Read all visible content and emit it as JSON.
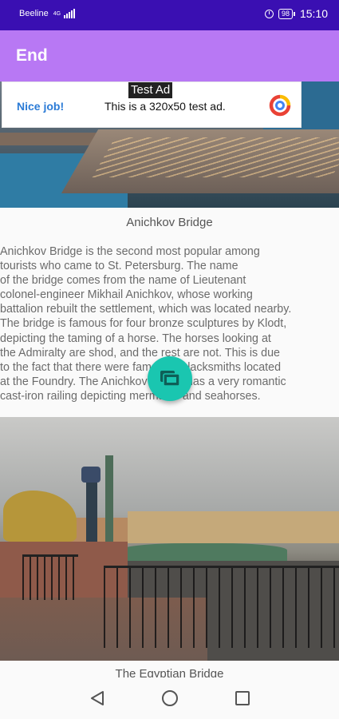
{
  "status_bar": {
    "carrier": "Beeline",
    "network": "4G",
    "battery": "98",
    "time": "15:10"
  },
  "app_bar": {
    "title": "End"
  },
  "ad": {
    "tag": "Test Ad",
    "headline": "Nice job!",
    "body": "This is a 320x50 test ad."
  },
  "content": {
    "caption1": "Anichkov Bridge",
    "description": "Anichkov Bridge is the second most popular among\ntourists who came to St. Petersburg. The name\nof the bridge comes from the name of Lieutenant\ncolonel-engineer Mikhail Anichkov, whose working\nbattalion rebuilt the settlement, which was located nearby.\nThe bridge is famous for four bronze sculptures by Klodt,\ndepicting the taming of a horse. The horses looking at\nthe Admiralty are shod, and the rest are not. This is due\nto the fact that there were famously blacksmiths located\nat the Foundry. The Anichkov Bridge has a very romantic\ncast-iron railing depicting mermaids and seahorses.",
    "caption2": "The Egyptian Bridge"
  },
  "icons": {
    "fab": "slideshow-icon",
    "nav_back": "back-triangle-icon",
    "nav_home": "home-circle-icon",
    "nav_recent": "recent-square-icon"
  },
  "colors": {
    "status_bar": "#3a0fb2",
    "app_bar": "#b878f4",
    "fab": "#1ac6b0",
    "ad_headline": "#2b7bd6"
  }
}
